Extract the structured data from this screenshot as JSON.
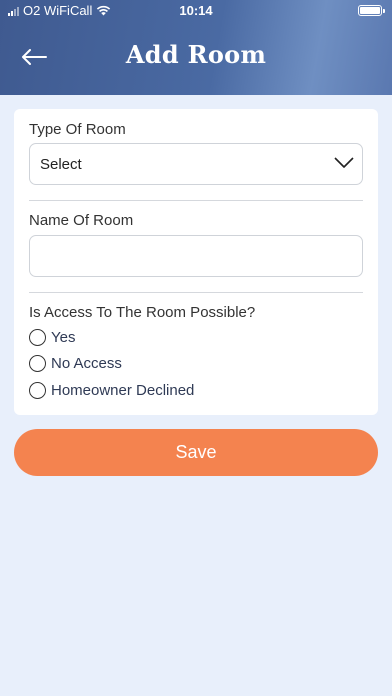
{
  "status_bar": {
    "carrier": "O2 WiFiCall",
    "time": "10:14"
  },
  "header": {
    "title": "Add Room",
    "back_icon": "arrow-left-icon"
  },
  "form": {
    "type_of_room": {
      "label": "Type Of Room",
      "value": "Select"
    },
    "name_of_room": {
      "label": "Name Of Room",
      "value": ""
    },
    "access": {
      "question": "Is Access To The Room Possible?",
      "options": [
        "Yes",
        "No Access",
        "Homeowner Declined"
      ]
    }
  },
  "save_label": "Save",
  "colors": {
    "accent": "#f4834f",
    "header": "#4a6aa3",
    "background": "#e8effb"
  }
}
